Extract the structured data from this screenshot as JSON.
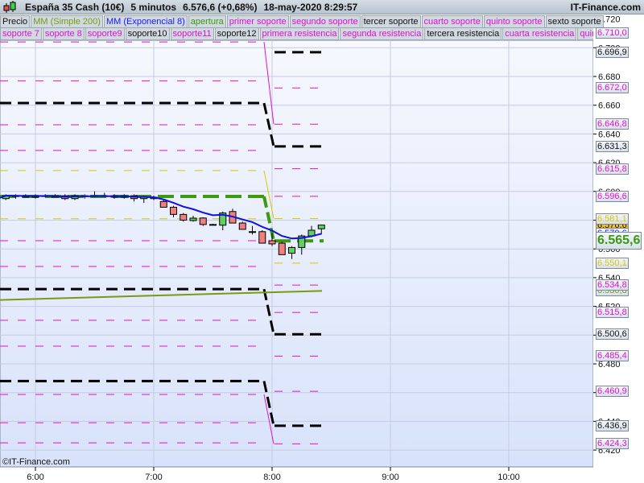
{
  "header": {
    "instrument": "España 35 Cash (10€)",
    "timeframe": "5 minutos",
    "price": "6.576,6 (+0,68%)",
    "datetime": "18-may-2020 8:29:57",
    "brand": "IT-Finance.com"
  },
  "legend_row1": [
    {
      "label": "Precio",
      "color": "#111111"
    },
    {
      "label": "MM (Simple 200)",
      "color": "#7a9a10"
    },
    {
      "label": "MM (Exponencial 8)",
      "color": "#1a1aff"
    },
    {
      "label": "apertura",
      "color": "#3a9a10"
    },
    {
      "label": "primer soporte",
      "color": "#e010d0"
    },
    {
      "label": "segundo soporte",
      "color": "#e010d0"
    },
    {
      "label": "tercer soporte",
      "color": "#111111"
    },
    {
      "label": "cuarto soporte",
      "color": "#e010d0"
    },
    {
      "label": "quinto soporte",
      "color": "#e010d0"
    },
    {
      "label": "sexto soporte",
      "color": "#111111"
    }
  ],
  "legend_row2": [
    {
      "label": "soporte 7",
      "color": "#e010d0"
    },
    {
      "label": "soporte 8",
      "color": "#e010d0"
    },
    {
      "label": "soporte9",
      "color": "#e010d0"
    },
    {
      "label": "soporte10",
      "color": "#111111"
    },
    {
      "label": "soporte11",
      "color": "#e010d0"
    },
    {
      "label": "soporte12",
      "color": "#111111"
    },
    {
      "label": "primera resistencia",
      "color": "#e010d0"
    },
    {
      "label": "segunda resistencia",
      "color": "#e010d0"
    },
    {
      "label": "tercera resistencia",
      "color": "#111111"
    },
    {
      "label": "cuarta resistencia",
      "color": "#e010d0"
    },
    {
      "label": "quinta resistencia",
      "color": "#e010d0"
    }
  ],
  "copyright": "©IT-Finance.com",
  "chart_data": {
    "type": "candlestick",
    "title": "España 35 Cash (10€) 5 minutos",
    "x_ticks": [
      "6:00",
      "7:00",
      "8:00",
      "9:00",
      "10:00"
    ],
    "y_ticks": [
      "6.720",
      "6.700",
      "6.680",
      "6.660",
      "6.640",
      "6.620",
      "6.600",
      "6.580",
      "6.560",
      "6.540",
      "6.520",
      "6.500",
      "6.480",
      "6.460",
      "6.440",
      "6.420"
    ],
    "ylim": [
      6.414,
      6.728
    ],
    "candles": [
      {
        "t": "5:45",
        "o": 6.595,
        "h": 6.598,
        "l": 6.594,
        "c": 6.597
      },
      {
        "t": "5:50",
        "o": 6.597,
        "h": 6.598,
        "l": 6.595,
        "c": 6.597
      },
      {
        "t": "5:55",
        "o": 6.597,
        "h": 6.598,
        "l": 6.596,
        "c": 6.596
      },
      {
        "t": "6:00",
        "o": 6.596,
        "h": 6.598,
        "l": 6.595,
        "c": 6.597
      },
      {
        "t": "6:05",
        "o": 6.597,
        "h": 6.598,
        "l": 6.596,
        "c": 6.597
      },
      {
        "t": "6:10",
        "o": 6.597,
        "h": 6.598,
        "l": 6.596,
        "c": 6.596
      },
      {
        "t": "6:15",
        "o": 6.597,
        "h": 6.598,
        "l": 6.594,
        "c": 6.595
      },
      {
        "t": "6:20",
        "o": 6.595,
        "h": 6.598,
        "l": 6.594,
        "c": 6.597
      },
      {
        "t": "6:25",
        "o": 6.597,
        "h": 6.598,
        "l": 6.595,
        "c": 6.597
      },
      {
        "t": "6:30",
        "o": 6.597,
        "h": 6.6,
        "l": 6.596,
        "c": 6.597
      },
      {
        "t": "6:35",
        "o": 6.597,
        "h": 6.599,
        "l": 6.596,
        "c": 6.597
      },
      {
        "t": "6:40",
        "o": 6.597,
        "h": 6.598,
        "l": 6.595,
        "c": 6.596
      },
      {
        "t": "6:45",
        "o": 6.596,
        "h": 6.598,
        "l": 6.595,
        "c": 6.597
      },
      {
        "t": "6:50",
        "o": 6.597,
        "h": 6.598,
        "l": 6.593,
        "c": 6.595
      },
      {
        "t": "6:55",
        "o": 6.595,
        "h": 6.597,
        "l": 6.592,
        "c": 6.596
      },
      {
        "t": "7:00",
        "o": 6.596,
        "h": 6.597,
        "l": 6.594,
        "c": 6.595
      },
      {
        "t": "7:05",
        "o": 6.593,
        "h": 6.594,
        "l": 6.589,
        "c": 6.589
      },
      {
        "t": "7:10",
        "o": 6.589,
        "h": 6.59,
        "l": 6.582,
        "c": 6.584
      },
      {
        "t": "7:15",
        "o": 6.584,
        "h": 6.585,
        "l": 6.579,
        "c": 6.58
      },
      {
        "t": "7:20",
        "o": 6.5797,
        "h": 6.583,
        "l": 6.579,
        "c": 6.5814
      },
      {
        "t": "7:25",
        "o": 6.5815,
        "h": 6.582,
        "l": 6.576,
        "c": 6.577
      },
      {
        "t": "7:30",
        "o": 6.577,
        "h": 6.5775,
        "l": 6.5765,
        "c": 6.577
      },
      {
        "t": "7:35",
        "o": 6.5765,
        "h": 6.586,
        "l": 6.573,
        "c": 6.585
      },
      {
        "t": "7:40",
        "o": 6.586,
        "h": 6.588,
        "l": 6.578,
        "c": 6.578
      },
      {
        "t": "7:45",
        "o": 6.578,
        "h": 6.579,
        "l": 6.5736,
        "c": 6.5736
      },
      {
        "t": "7:50",
        "o": 6.572,
        "h": 6.576,
        "l": 6.57,
        "c": 6.572
      },
      {
        "t": "7:55",
        "o": 6.572,
        "h": 6.573,
        "l": 6.564,
        "c": 6.564
      },
      {
        "t": "8:00",
        "o": 6.5657,
        "h": 6.571,
        "l": 6.562,
        "c": 6.5635
      },
      {
        "t": "8:05",
        "o": 6.564,
        "h": 6.565,
        "l": 6.556,
        "c": 6.556
      },
      {
        "t": "8:10",
        "o": 6.557,
        "h": 6.562,
        "l": 6.553,
        "c": 6.561
      },
      {
        "t": "8:15",
        "o": 6.561,
        "h": 6.57,
        "l": 6.556,
        "c": 6.569
      },
      {
        "t": "8:20",
        "o": 6.569,
        "h": 6.576,
        "l": 6.568,
        "c": 6.573
      },
      {
        "t": "8:25",
        "o": 6.574,
        "h": 6.577,
        "l": 6.57,
        "c": 6.5766
      }
    ],
    "sma200": [
      6.5245,
      6.5308
    ],
    "levels_previous": [
      {
        "v": 6.704,
        "color": "#e010d0",
        "style": "thin"
      },
      {
        "v": 6.677,
        "color": "#e010d0",
        "style": "thin"
      },
      {
        "v": 6.6615,
        "color": "#000000",
        "style": "thick"
      },
      {
        "v": 6.6464,
        "color": "#e010d0",
        "style": "thin"
      },
      {
        "v": 6.6285,
        "color": "#e010d0",
        "style": "thin"
      },
      {
        "v": 6.6145,
        "color": "#d8c800",
        "style": "thin"
      },
      {
        "v": 6.5965,
        "color": "#3a9a10",
        "style": "open"
      },
      {
        "v": 6.581,
        "color": "#d8c800",
        "style": "thin"
      },
      {
        "v": 6.5657,
        "color": "#e010d0",
        "style": "thin"
      },
      {
        "v": 6.5478,
        "color": "#e010d0",
        "style": "thin"
      },
      {
        "v": 6.532,
        "color": "#000000",
        "style": "thick"
      },
      {
        "v": 6.5103,
        "color": "#e010d0",
        "style": "thin"
      },
      {
        "v": 6.4923,
        "color": "#e010d0",
        "style": "thin"
      },
      {
        "v": 6.468,
        "color": "#000000",
        "style": "thick"
      },
      {
        "v": 6.4587,
        "color": "#e010d0",
        "style": "thin"
      },
      {
        "v": 6.439,
        "color": "#e010d0",
        "style": "thin"
      },
      {
        "v": 6.425,
        "color": "#e010d0",
        "style": "thin"
      }
    ],
    "levels_current": [
      {
        "v": 6.71,
        "label": "6.710,0",
        "color": "#e010d0",
        "style": "thin"
      },
      {
        "v": 6.6969,
        "label": "6.696,9",
        "color": "#000000",
        "style": "thick"
      },
      {
        "v": 6.672,
        "label": "6.672,0",
        "color": "#e010d0",
        "style": "thin"
      },
      {
        "v": 6.6468,
        "label": "6.646,8",
        "color": "#e010d0",
        "style": "thin"
      },
      {
        "v": 6.6313,
        "label": "6.631,3",
        "color": "#000000",
        "style": "thick"
      },
      {
        "v": 6.6158,
        "label": "6.615,8",
        "color": "#e010d0",
        "style": "thin"
      },
      {
        "v": 6.5966,
        "label": "6.596,6",
        "color": "#e010d0",
        "style": "thin"
      },
      {
        "v": 6.5811,
        "label": "6.581,1",
        "color": "#d8c800",
        "style": "thin"
      },
      {
        "v": 6.5656,
        "label": "6.565,6",
        "color": "#3a9a10",
        "style": "open"
      },
      {
        "v": 6.5501,
        "label": "6.550,1",
        "color": "#d8c800",
        "style": "thin"
      },
      {
        "v": 6.5348,
        "label": "6.534,8",
        "color": "#e010d0",
        "style": "thin"
      },
      {
        "v": 6.5158,
        "label": "6.515,8",
        "color": "#e010d0",
        "style": "thin"
      },
      {
        "v": 6.5006,
        "label": "6.500,6",
        "color": "#000000",
        "style": "thick"
      },
      {
        "v": 6.4854,
        "label": "6.485,4",
        "color": "#e010d0",
        "style": "thin"
      },
      {
        "v": 6.4609,
        "label": "6.460,9",
        "color": "#e010d0",
        "style": "thin"
      },
      {
        "v": 6.4369,
        "label": "6.436,9",
        "color": "#000000",
        "style": "thick"
      },
      {
        "v": 6.4243,
        "label": "6.424,3",
        "color": "#e010d0",
        "style": "thin"
      }
    ],
    "price_labels_extra": [
      {
        "v": 6.5766,
        "label": "6.576,6",
        "color": "#000000",
        "bg": "#f8c020"
      },
      {
        "v": 6.5706,
        "label": "6.570,6",
        "color": "#1a1aff"
      },
      {
        "v": 6.5308,
        "label": "6.530,8",
        "color": "#7a9a10"
      }
    ],
    "colors": {
      "up": "#60d060",
      "down": "#f08080",
      "ema": "#1010e0",
      "sma": "#7a9a10"
    }
  }
}
